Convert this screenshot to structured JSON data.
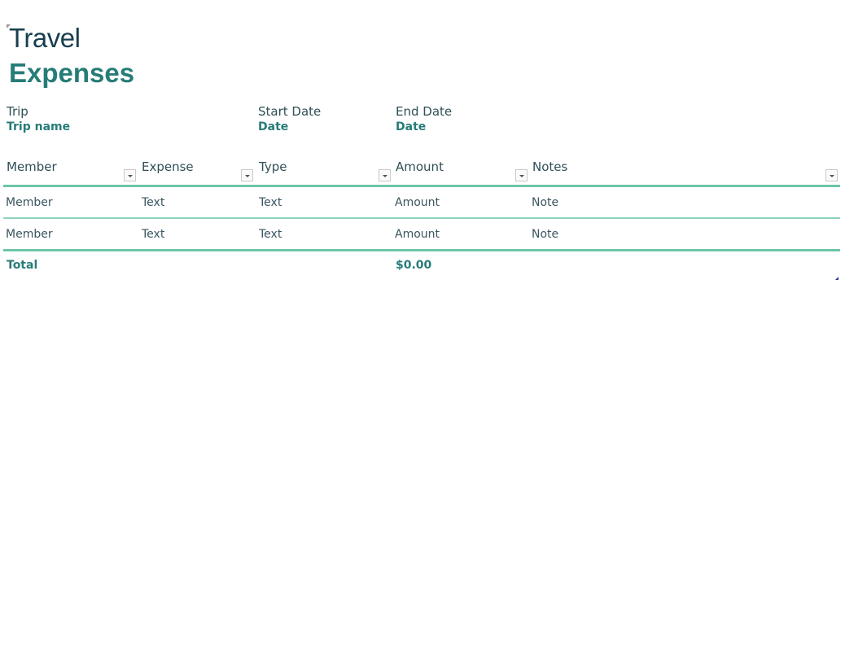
{
  "document": {
    "title_line1": "Travel",
    "title_line2": "Expenses"
  },
  "trip_info": {
    "trip_label": "Trip",
    "trip_value": "Trip name",
    "start_label": "Start Date",
    "start_value": "Date",
    "end_label": "End Date",
    "end_value": "Date"
  },
  "table": {
    "columns": [
      "Member",
      "Expense",
      "Type",
      "Amount",
      "Notes"
    ],
    "rows": [
      [
        "Member",
        "Text",
        "Text",
        "Amount",
        "Note"
      ],
      [
        "Member",
        "Text",
        "Text",
        "Amount",
        "Note"
      ]
    ],
    "total_label": "Total",
    "total_amount": "$0.00"
  },
  "colors": {
    "title_dark": "#173f4f",
    "accent_teal": "#267c78",
    "rule_green": "#6cc5a7"
  }
}
